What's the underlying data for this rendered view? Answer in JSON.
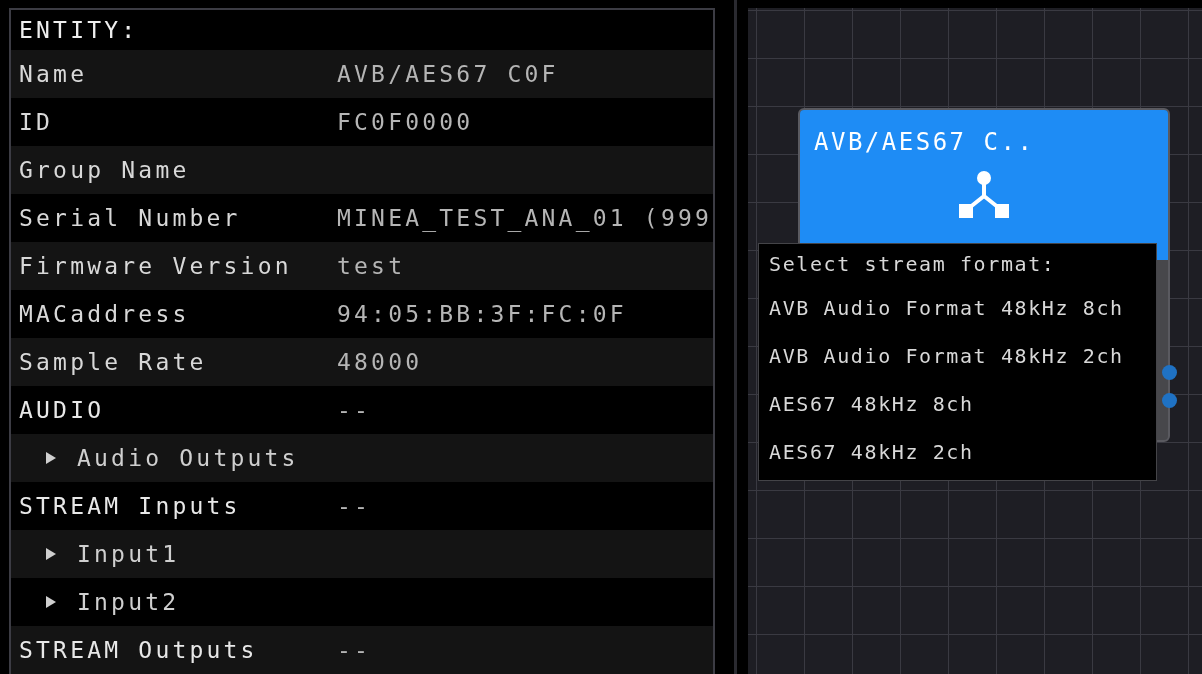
{
  "entity_panel": {
    "title": "ENTITY:",
    "rows": [
      {
        "kind": "field",
        "label": "Name",
        "value": "AVB/AES67 C0F"
      },
      {
        "kind": "field",
        "label": "ID",
        "value": "FC0F0000"
      },
      {
        "kind": "field",
        "label": "Group Name"
      },
      {
        "kind": "field",
        "label": "Serial Number",
        "value": "MINEA_TEST_ANA_01 (999"
      },
      {
        "kind": "field",
        "label": "Firmware Version",
        "value": "test"
      },
      {
        "kind": "field",
        "label": "MACaddress",
        "value": "94:05:BB:3F:FC:0F"
      },
      {
        "kind": "field",
        "label": "Sample Rate",
        "value": "48000"
      },
      {
        "kind": "section",
        "label": "AUDIO",
        "value": "--"
      },
      {
        "kind": "expander",
        "label": "Audio Outputs",
        "expanded": false
      },
      {
        "kind": "section",
        "label": "STREAM Inputs",
        "value": "--"
      },
      {
        "kind": "expander",
        "label": "Input1",
        "expanded": false
      },
      {
        "kind": "expander",
        "label": "Input2",
        "expanded": false
      },
      {
        "kind": "section",
        "label": "STREAM Outputs",
        "value": "--"
      }
    ]
  },
  "canvas": {
    "node": {
      "title": "AVB/AES67 C.."
    },
    "format_menu": {
      "title": "Select stream format:",
      "items": [
        {
          "label": "AVB Audio Format 48kHz 8ch"
        },
        {
          "label": "AVB Audio Format 48kHz 2ch"
        },
        {
          "label": "AES67 48kHz 8ch"
        },
        {
          "label": "AES67 48kHz 2ch"
        }
      ]
    }
  }
}
